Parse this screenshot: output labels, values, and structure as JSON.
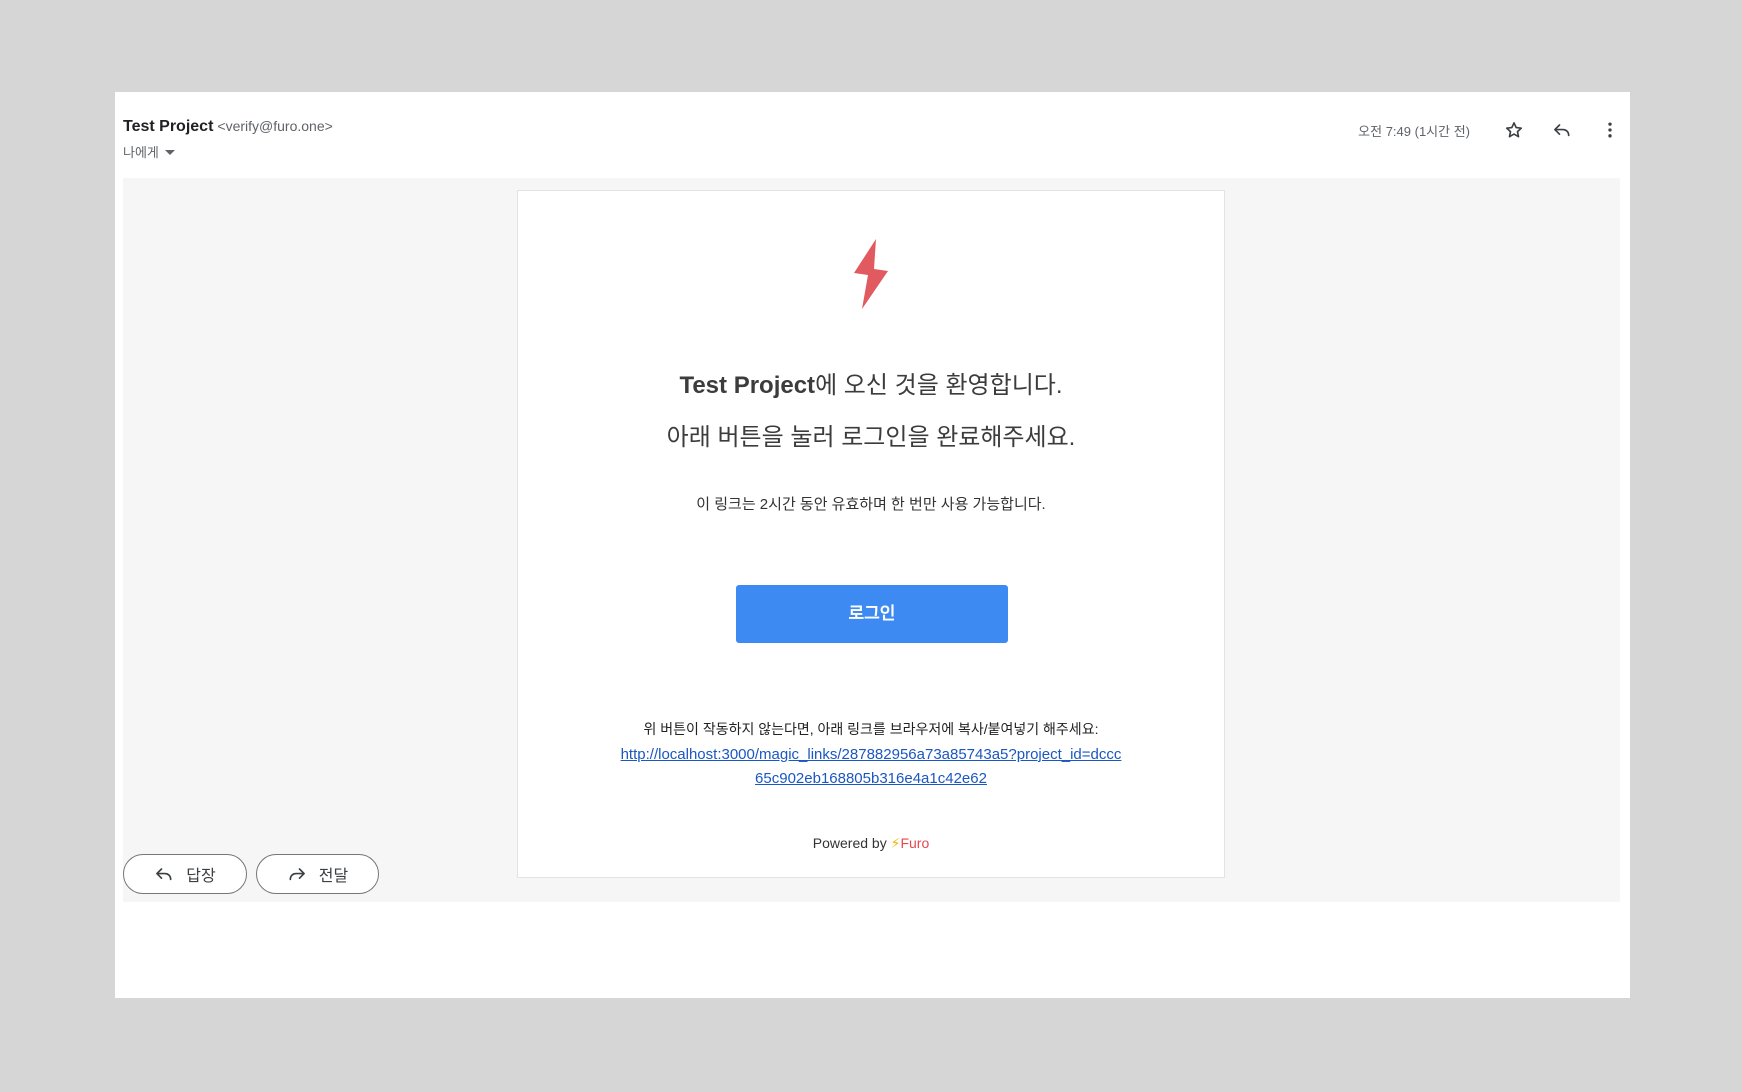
{
  "email": {
    "sender_name": "Test Project",
    "sender_email": "<verify@furo.one>",
    "recipient_label": "나에게",
    "time": "오전 7:49 (1시간 전)"
  },
  "icons": [
    "star-icon",
    "reply-icon",
    "more-vert-icon",
    "lightning-bolt-icon",
    "forward-icon"
  ],
  "content": {
    "welcome_project": "Test Project",
    "welcome_suffix": "에 오신 것을 환영합니다.",
    "instruction": "아래 버튼을 눌러 로그인을 완료해주세요.",
    "validity": "이 링크는 2시간 동안 유효하며 한 번만 사용 가능합니다.",
    "login_button": "로그인",
    "fallback_text": "위 버튼이 작동하지 않는다면, 아래 링크를 브라우저에 복사/붙여넣기 해주세요:",
    "magic_link": "http://localhost:3000/magic_links/287882956a73a85743a5?project_id=dccc65c902eb168805b316e4a1c42e62",
    "powered_by": "Powered by",
    "brand_glyph": "⚡",
    "brand_name": "Furo"
  },
  "actions": {
    "reply_label": "답장",
    "forward_label": "전달"
  },
  "colors": {
    "login_button_bg": "#3d8bf2",
    "brand_red": "#e5484d",
    "link": "#1a57c2"
  }
}
